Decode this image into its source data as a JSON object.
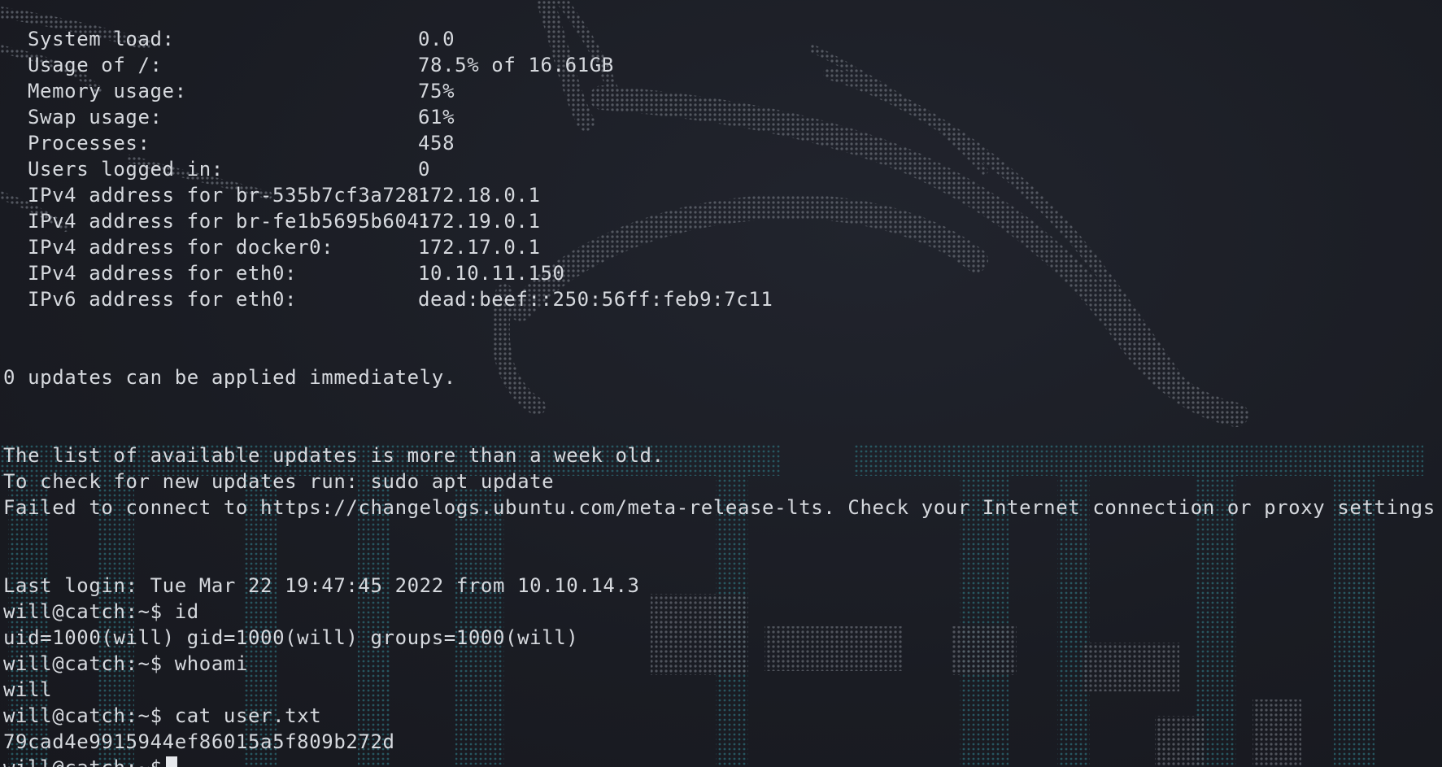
{
  "sysinfo": [
    {
      "label": "System load:",
      "value": "0.0"
    },
    {
      "label": "Usage of /:",
      "value": "78.5% of 16.61GB"
    },
    {
      "label": "Memory usage:",
      "value": "75%"
    },
    {
      "label": "Swap usage:",
      "value": "61%"
    },
    {
      "label": "Processes:",
      "value": "458"
    },
    {
      "label": "Users logged in:",
      "value": "0"
    },
    {
      "label": "IPv4 address for br-535b7cf3a728:",
      "value": "172.18.0.1"
    },
    {
      "label": "IPv4 address for br-fe1b5695b604:",
      "value": "172.19.0.1"
    },
    {
      "label": "IPv4 address for docker0:",
      "value": "172.17.0.1"
    },
    {
      "label": "IPv4 address for eth0:",
      "value": "10.10.11.150"
    },
    {
      "label": "IPv6 address for eth0:",
      "value": "dead:beef::250:56ff:feb9:7c11"
    }
  ],
  "messages": {
    "updates_applied": "0 updates can be applied immediately.",
    "list_old": "The list of available updates is more than a week old.",
    "check_updates": "To check for new updates run: sudo apt update",
    "failed_connect": "Failed to connect to https://changelogs.ubuntu.com/meta-release-lts. Check your Internet connection or proxy settings",
    "last_login": "Last login: Tue Mar 22 19:47:45 2022 from 10.10.14.3"
  },
  "session": {
    "prompt": "will@catch:~$",
    "cmd_id": "id",
    "out_id": "uid=1000(will) gid=1000(will) groups=1000(will)",
    "cmd_whoami": "whoami",
    "out_whoami": "will",
    "cmd_cat": "cat user.txt",
    "out_cat": "79cad4e9915944ef86015a5f809b272d"
  },
  "theme": {
    "background": "#1b1d25",
    "foreground": "#d6d9de",
    "wallpaper_gray": "#5a5e66",
    "wallpaper_teal": "#2f6f78"
  }
}
